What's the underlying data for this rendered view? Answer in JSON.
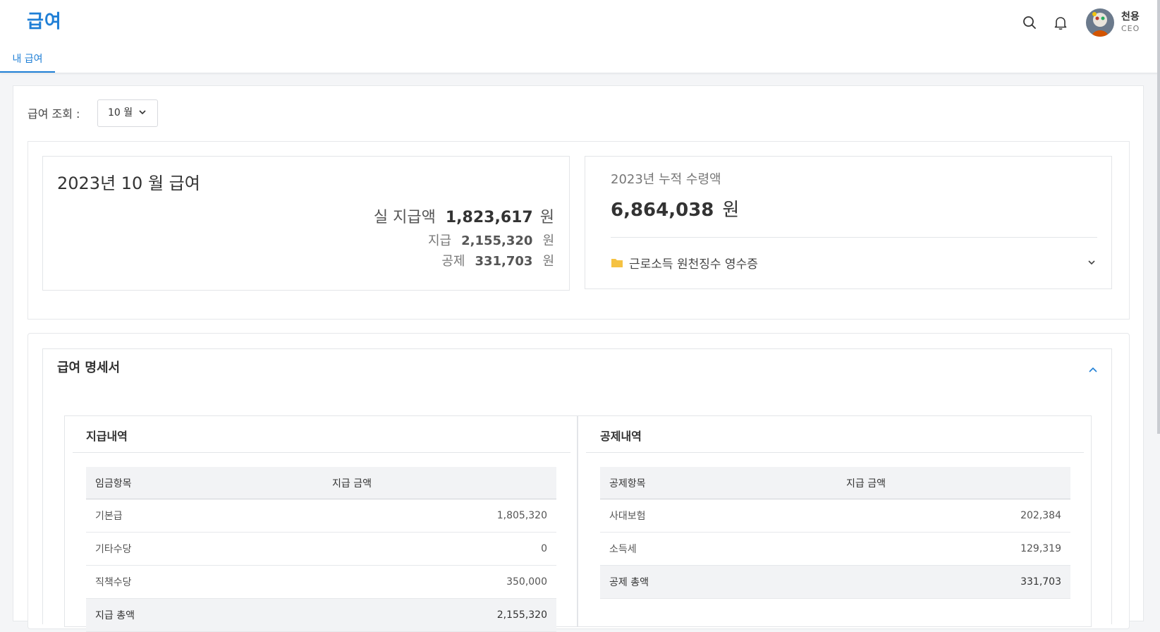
{
  "header": {
    "app_title": "급여",
    "tabs": [
      {
        "label": "내 급여",
        "active": true
      }
    ],
    "user": {
      "name": "천용",
      "role": "CEO"
    },
    "accent_color": "#1f7fd6"
  },
  "filter": {
    "label": "급여 조회 :",
    "month_value": "10 월"
  },
  "summary": {
    "title": "2023년 10 월 급여",
    "net": {
      "label": "실 지급액",
      "value": "1,823,617",
      "unit": "원"
    },
    "pay": {
      "label": "지급",
      "value": "2,155,320",
      "unit": "원"
    },
    "deduction": {
      "label": "공제",
      "value": "331,703",
      "unit": "원"
    }
  },
  "accumulated": {
    "title": "2023년 누적 수령액",
    "value": "6,864,038",
    "unit": "원",
    "receipt_label": "근로소득 원천징수 영수증"
  },
  "payslip": {
    "title": "급여 명세서",
    "payments": {
      "title": "지급내역",
      "headers": [
        "임금항목",
        "지급 금액"
      ],
      "rows": [
        {
          "item": "기본급",
          "amount": "1,805,320"
        },
        {
          "item": "기타수당",
          "amount": "0"
        },
        {
          "item": "직책수당",
          "amount": "350,000"
        }
      ],
      "total": {
        "item": "지급 총액",
        "amount": "2,155,320"
      }
    },
    "deductions": {
      "title": "공제내역",
      "headers": [
        "공제항목",
        "지급 금액"
      ],
      "rows": [
        {
          "item": "사대보험",
          "amount": "202,384"
        },
        {
          "item": "소득세",
          "amount": "129,319"
        }
      ],
      "total": {
        "item": "공제 총액",
        "amount": "331,703"
      }
    }
  },
  "icons": [
    "search-icon",
    "bell-icon",
    "chevron-down-icon",
    "folder-icon",
    "chevron-up-icon"
  ]
}
